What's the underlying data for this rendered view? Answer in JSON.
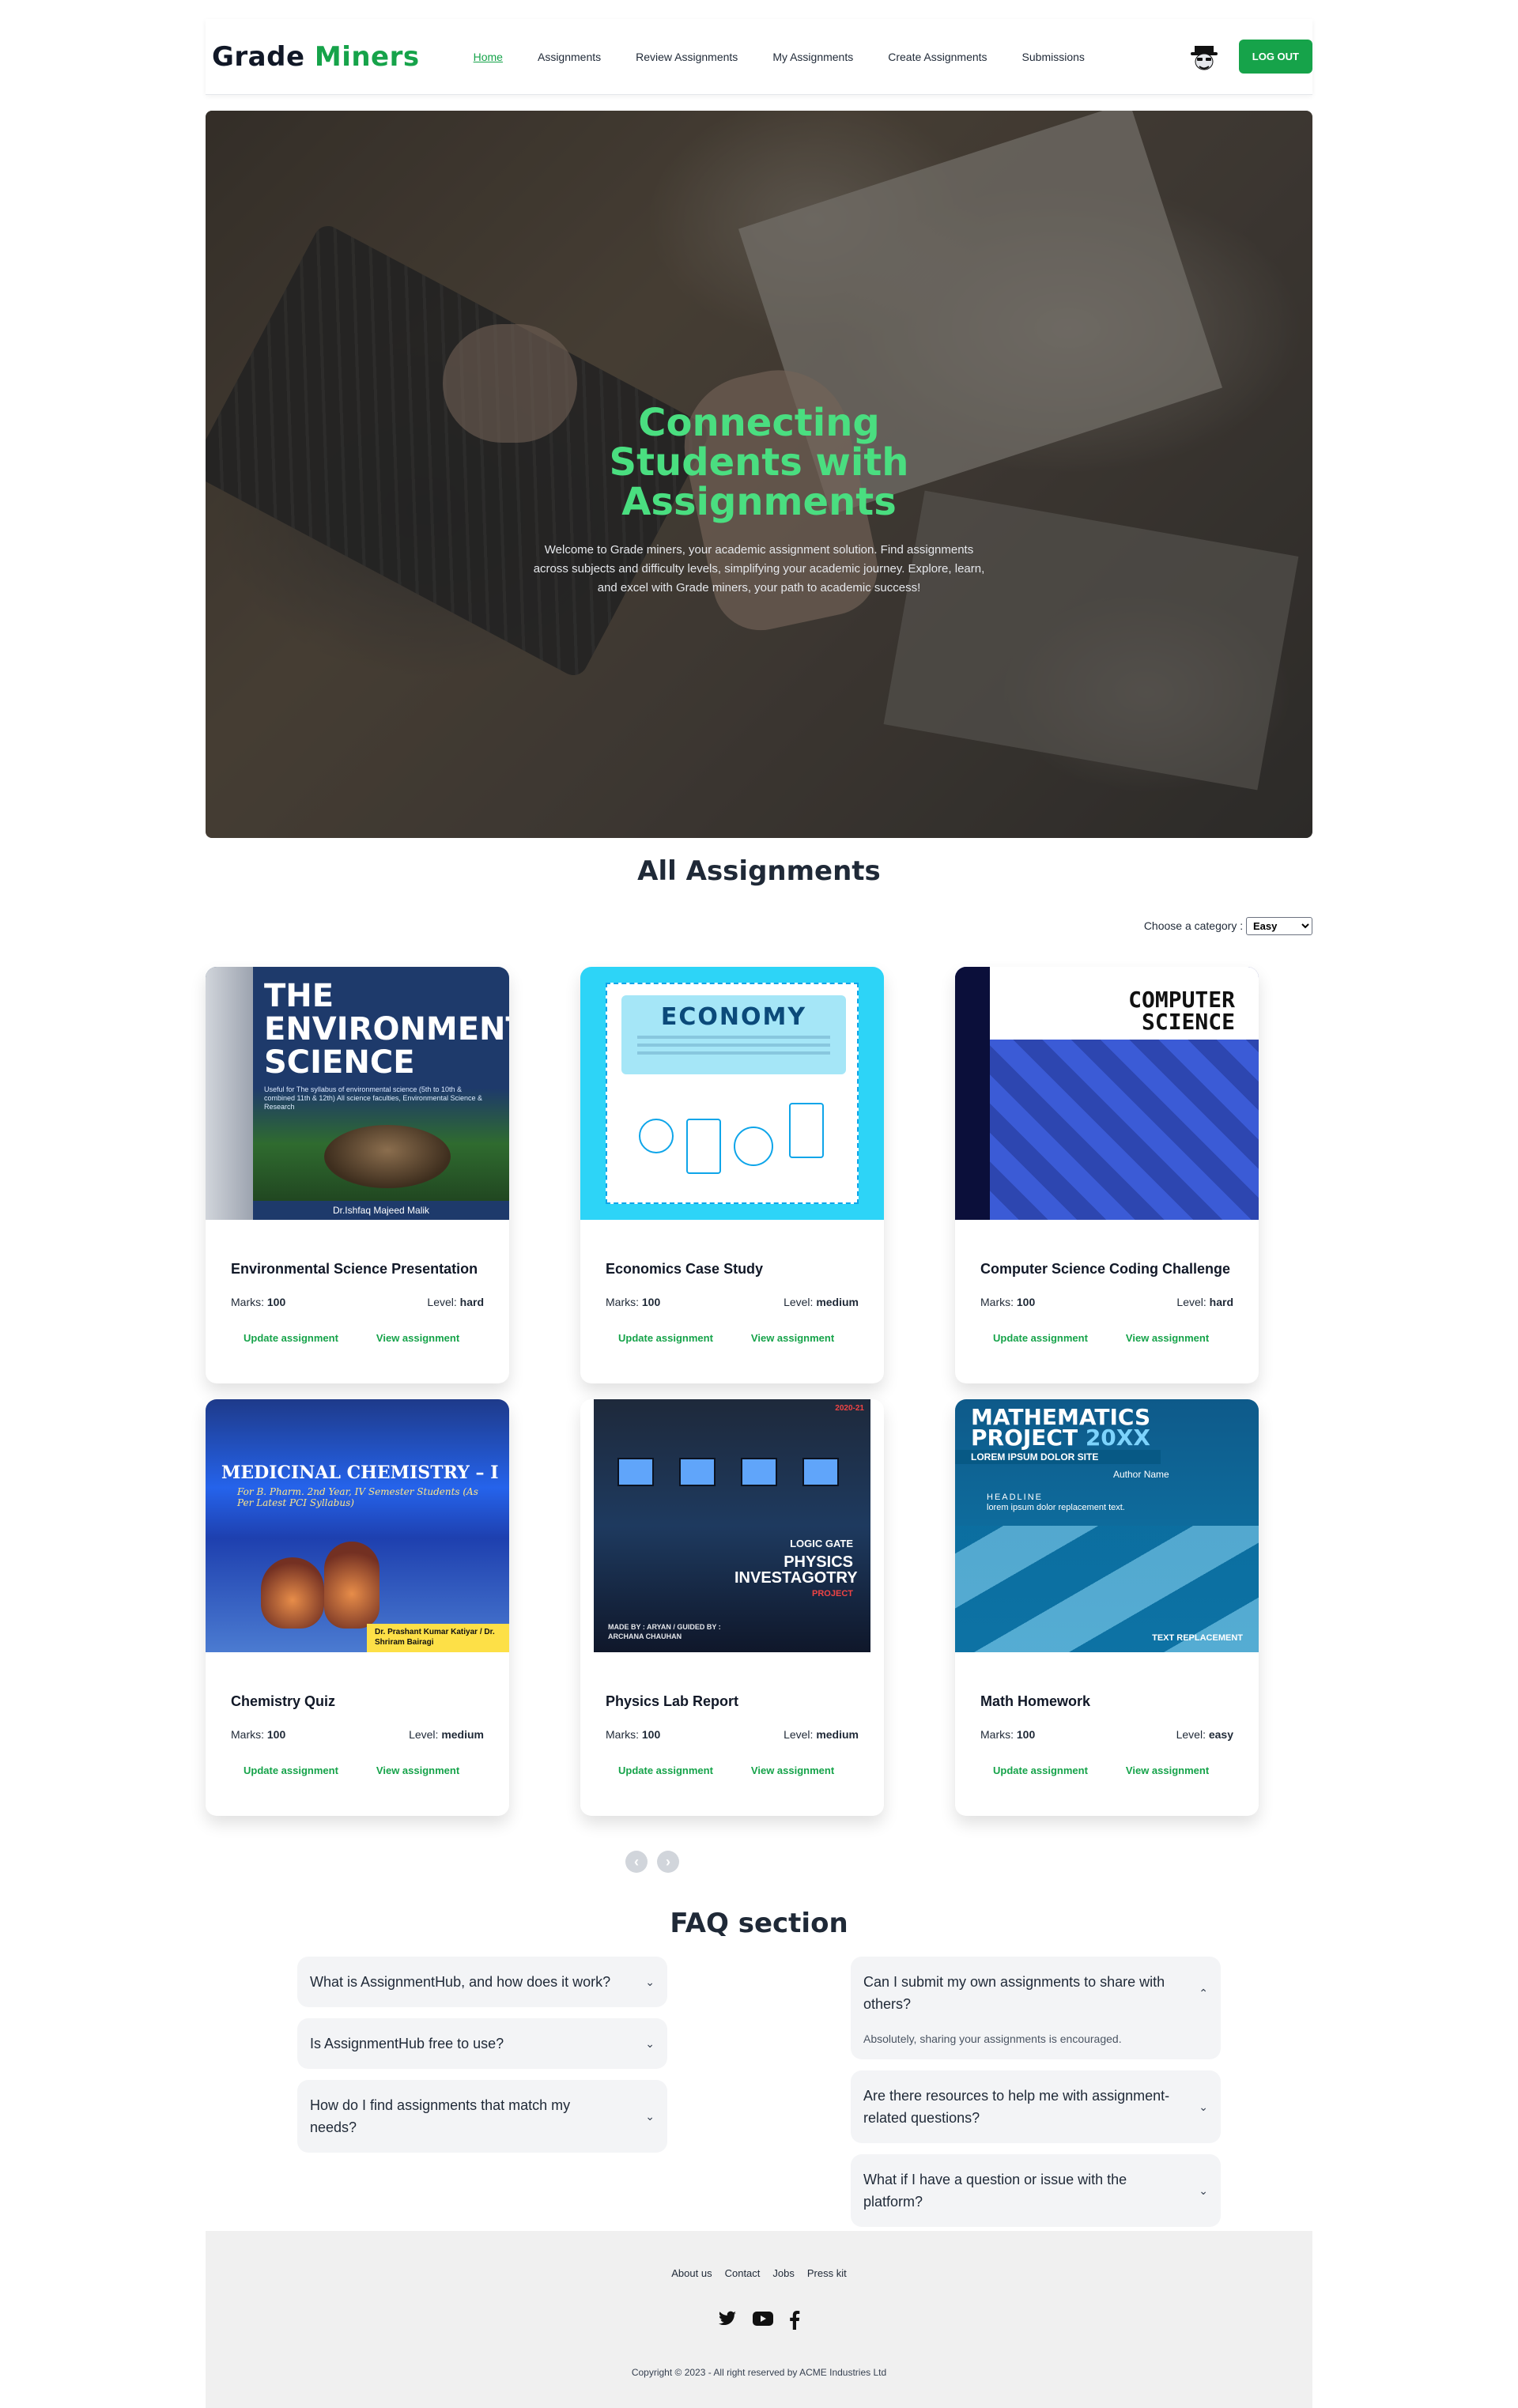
{
  "brand": {
    "first": "Grade",
    "second": "Miners"
  },
  "nav": {
    "items": [
      "Home",
      "Assignments",
      "Review Assignments",
      "My Assignments",
      "Create Assignments",
      "Submissions"
    ],
    "active": "Home",
    "logout_label": "LOG OUT"
  },
  "hero": {
    "title": "Connecting Students with Assignments",
    "description": "Welcome to Grade miners, your academic assignment solution. Find assignments across subjects and difficulty levels, simplifying your academic journey. Explore, learn, and excel with Grade miners, your path to academic success!"
  },
  "assignments": {
    "title": "All Assignments",
    "filter_label": "Choose a category :",
    "filter_value": "Easy",
    "marks_label": "Marks:",
    "level_label": "Level:",
    "update_label": "Update assignment",
    "view_label": "View assignment",
    "items": [
      {
        "title": "Environmental Science Presentation",
        "marks": "100",
        "level": "hard",
        "cover": "environmental-science-cover"
      },
      {
        "title": "Economics Case Study",
        "marks": "100",
        "level": "medium",
        "cover": "economy-cover"
      },
      {
        "title": "Computer Science Coding Challenge",
        "marks": "100",
        "level": "hard",
        "cover": "computer-science-cover"
      },
      {
        "title": "Chemistry Quiz",
        "marks": "100",
        "level": "medium",
        "cover": "medicinal-chemistry-cover"
      },
      {
        "title": "Physics Lab Report",
        "marks": "100",
        "level": "medium",
        "cover": "physics-cover"
      },
      {
        "title": "Math Homework",
        "marks": "100",
        "level": "easy",
        "cover": "mathematics-cover"
      }
    ]
  },
  "covers": {
    "env": {
      "title": "THE ENVIRONMENTAL SCIENCE",
      "subtitle": "Useful for The syllabus of environmental science (5th to 10th & combined 11th & 12th) All science faculties, Environmental Science & Research",
      "author": "Dr.Ishfaq Majeed Malik"
    },
    "eco": {
      "title": "ECONOMY"
    },
    "cs": {
      "title": "COMPUTER SCIENCE"
    },
    "chem": {
      "title": "MEDICINAL CHEMISTRY – I",
      "subtitle": "For B. Pharm. 2nd Year, IV Semester Students (As Per Latest PCI Syllabus)",
      "authors": "Dr. Prashant Kumar Katiyar / Dr. Shriram Bairagi"
    },
    "phy": {
      "tag": "LOGIC GATE",
      "title": "PHYSICS INVESTAGOTRY",
      "project": "PROJECT",
      "credits": "MADE BY : ARYAN / GUIDED BY : ARCHANA CHAUHAN",
      "year": "2020-21"
    },
    "math": {
      "title_a": "MATHEMATICS",
      "title_b": "PROJECT",
      "title_year": "20XX",
      "bar": "LOREM IPSUM DOLOR SITE",
      "author": "Author Name",
      "headline": "HEADLINE",
      "headline_sub": "lorem ipsum dolor replacement text.",
      "footer": "TEXT REPLACEMENT"
    }
  },
  "pagination": {
    "prev": "‹",
    "next": "›"
  },
  "faq": {
    "title": "FAQ section",
    "left": [
      {
        "q": "What is AssignmentHub, and how does it work?",
        "open": false
      },
      {
        "q": "Is AssignmentHub free to use?",
        "open": false
      },
      {
        "q": "How do I find assignments that match my needs?",
        "open": false
      }
    ],
    "right": [
      {
        "q": "Can I submit my own assignments to share with others?",
        "open": true,
        "a": "Absolutely, sharing your assignments is encouraged."
      },
      {
        "q": "Are there resources to help me with assignment-related questions?",
        "open": false
      },
      {
        "q": "What if I have a question or issue with the platform?",
        "open": false
      }
    ]
  },
  "footer": {
    "links": [
      "About us",
      "Contact",
      "Jobs",
      "Press kit"
    ],
    "social": [
      "twitter-icon",
      "youtube-icon",
      "facebook-icon"
    ],
    "copyright": "Copyright © 2023 - All right reserved by ACME Industries Ltd"
  },
  "colors": {
    "accent": "#16a34a",
    "hero_title": "#4ade80",
    "text": "#1f2937"
  }
}
